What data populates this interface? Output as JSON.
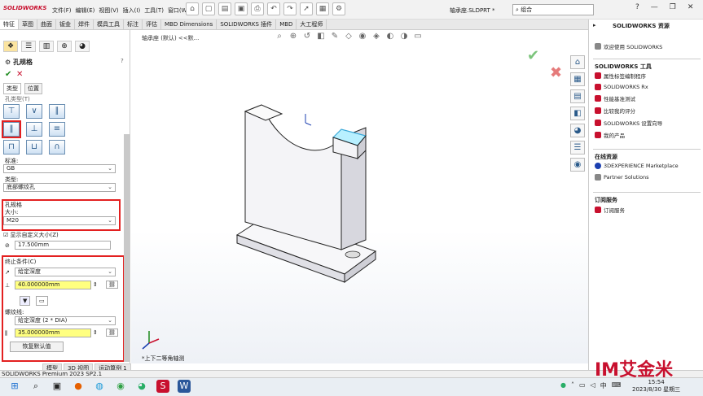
{
  "app": {
    "logo_text": "SOLIDWORKS",
    "doc_title": "轴承座.SLDPRT *",
    "search_placeholder": "组合",
    "status": "SOLIDWORKS Premium 2023 SP2.1"
  },
  "menus": [
    "文件(F)",
    "编辑(E)",
    "视图(V)",
    "插入(I)",
    "工具(T)",
    "窗口(W)"
  ],
  "toolbar_icons": [
    "home-icon",
    "new-icon",
    "open-icon",
    "save-icon",
    "print-icon",
    "undo-icon",
    "redo-icon",
    "select-icon",
    "rebuild-icon",
    "options-icon"
  ],
  "tabs": [
    "特征",
    "草图",
    "曲面",
    "钣金",
    "焊件",
    "模具工具",
    "标注",
    "评估",
    "MBD Dimensions",
    "SOLIDWORKS 插件",
    "MBD",
    "大工程师"
  ],
  "active_tab": "特征",
  "breadcrumb": "轴承座 (默认) <<默...",
  "orientation": "*上下二等角轴测",
  "property_manager": {
    "title": "孔规格",
    "help": "?",
    "subtabs": [
      "类型",
      "位置"
    ],
    "hole_spec_label": "孔类型(T)",
    "standard_label": "标准:",
    "standard_value": "GB",
    "type_label": "类型:",
    "type_value": "底部螺纹孔",
    "spec_section": "孔规格",
    "size_label": "大小:",
    "size_value": "M20",
    "custom_size_label": "显示自定义大小(Z)",
    "custom_size_value": "17.500mm",
    "end_condition_section": "终止条件(C)",
    "end_condition_value": "给定深度",
    "depth_value": "40.000000mm",
    "thread_label": "螺纹线:",
    "thread_value": "给定深度 (2 * DIA)",
    "thread_depth_value": "35.000000mm",
    "restore_button": "恢复默认值"
  },
  "bottom_tabs": [
    "模型",
    "3D 视图",
    "运动算例 1"
  ],
  "right_panel": {
    "title": "SOLIDWORKS 资源",
    "welcome": "欢迎使用 SOLIDWORKS",
    "tools_section": "SOLIDWORKS 工具",
    "tools": [
      "属性标签编制程序",
      "SOLIDWORKS Rx",
      "性能基准测试",
      "比较我的评分",
      "SOLIDWORKS 设置向导",
      "我的产品"
    ],
    "online_section": "在线资源",
    "online": [
      "3DEXPERIENCE Marketplace",
      "Partner Solutions"
    ],
    "subscription_section": "订阅服务",
    "subscription": [
      "订阅服务"
    ]
  },
  "clock": {
    "time": "15:54",
    "date": "2023/8/30 星期三"
  },
  "taskbar_lang": "中",
  "brand_text": "IM艾金米",
  "colors": {
    "accent": "#c8102e",
    "yellow_field": "#ffff80",
    "ok_green": "#1e8a1e"
  }
}
